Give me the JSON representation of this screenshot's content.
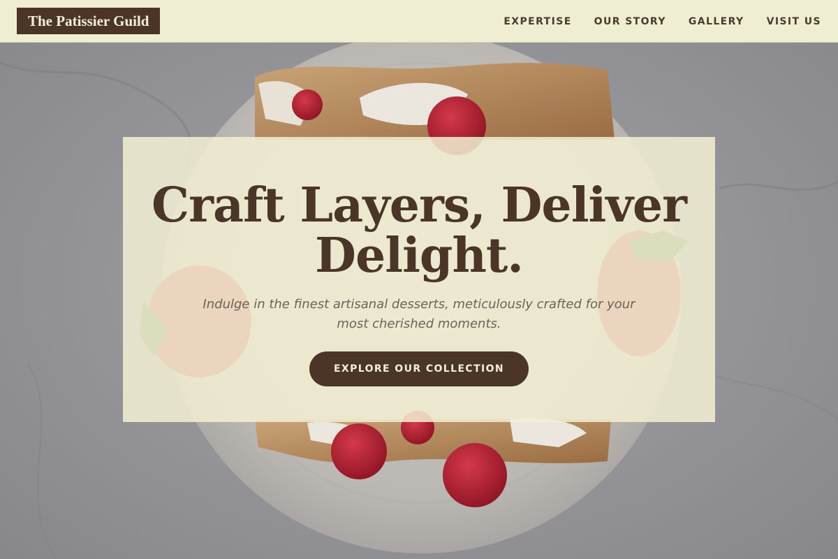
{
  "brand": {
    "logo_text": "The Patissier Guild"
  },
  "nav": {
    "items": [
      {
        "label": "EXPERTISE"
      },
      {
        "label": "OUR STORY"
      },
      {
        "label": "GALLERY"
      },
      {
        "label": "VISIT US"
      }
    ]
  },
  "hero": {
    "headline_line1": "Craft Layers, Deliver",
    "headline_line2": "Delight.",
    "subtitle_line1": "Indulge in the finest artisanal desserts, meticulously crafted for your",
    "subtitle_line2": "most cherished moments.",
    "cta_label": "EXPLORE OUR COLLECTION",
    "background_image": "crepes-with-strawberries-and-raspberries-on-plate"
  },
  "colors": {
    "primary_brown": "#4a3526",
    "cream": "#efedd2",
    "card_overlay": "#f2efd3",
    "muted_text": "#6c6357"
  }
}
